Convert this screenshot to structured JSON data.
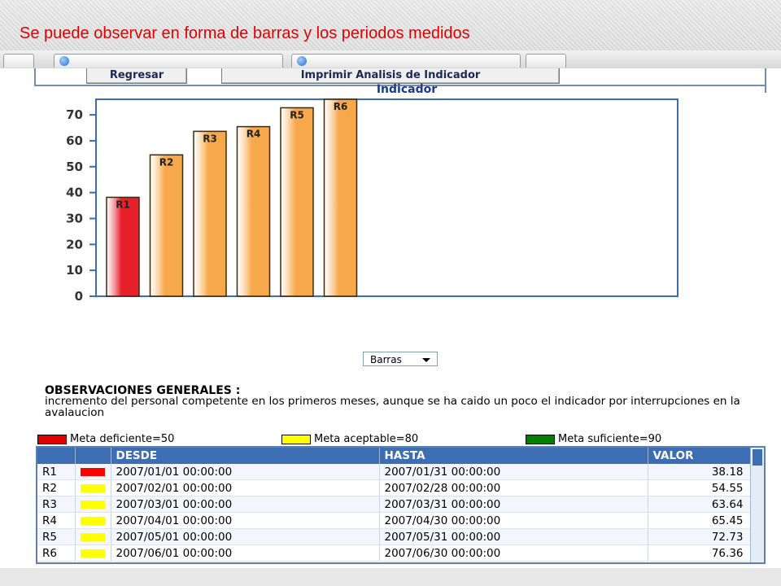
{
  "caption": "Se puede observar en forma de barras y los periodos medidos",
  "buttons": {
    "back": "Regresar",
    "print": "Imprimir Analisis de Indicador"
  },
  "chart_data": {
    "type": "bar",
    "title": "Indicador",
    "categories": [
      "R1",
      "R2",
      "R3",
      "R4",
      "R5",
      "R6"
    ],
    "values": [
      38.18,
      54.55,
      63.64,
      65.45,
      72.73,
      76.36
    ],
    "bar_colors": [
      "#e8202a",
      "#f7a84a",
      "#f7a84a",
      "#f7a84a",
      "#f7a84a",
      "#f7a84a"
    ],
    "yticks": [
      "0",
      "10",
      "20",
      "30",
      "40",
      "50",
      "60",
      "70"
    ],
    "ylim": [
      0,
      76
    ],
    "xlabel": "",
    "ylabel": ""
  },
  "chart_type_select": "Barras",
  "observations": {
    "title": "OBSERVACIONES GENERALES :",
    "text": "incremento del personal competente en los primeros meses, aunque se ha caido un poco el indicador por interrupciones en la avalaucion"
  },
  "legend": [
    {
      "label": "Meta deficiente=50",
      "color": "#e00000"
    },
    {
      "label": "Meta aceptable=80",
      "color": "#ffff00"
    },
    {
      "label": "Meta suficiente=90",
      "color": "#008000"
    }
  ],
  "table": {
    "headers": [
      "",
      "",
      "DESDE",
      "HASTA",
      "VALOR"
    ],
    "rows": [
      {
        "id": "R1",
        "color": "#ff0000",
        "desde": "2007/01/01 00:00:00",
        "hasta": "2007/01/31 00:00:00",
        "valor": "38.18"
      },
      {
        "id": "R2",
        "color": "#ffff00",
        "desde": "2007/02/01 00:00:00",
        "hasta": "2007/02/28 00:00:00",
        "valor": "54.55"
      },
      {
        "id": "R3",
        "color": "#ffff00",
        "desde": "2007/03/01 00:00:00",
        "hasta": "2007/03/31 00:00:00",
        "valor": "63.64"
      },
      {
        "id": "R4",
        "color": "#ffff00",
        "desde": "2007/04/01 00:00:00",
        "hasta": "2007/04/30 00:00:00",
        "valor": "65.45"
      },
      {
        "id": "R5",
        "color": "#ffff00",
        "desde": "2007/05/01 00:00:00",
        "hasta": "2007/05/31 00:00:00",
        "valor": "72.73"
      },
      {
        "id": "R6",
        "color": "#ffff00",
        "desde": "2007/06/01 00:00:00",
        "hasta": "2007/06/30 00:00:00",
        "valor": "76.36"
      }
    ]
  }
}
